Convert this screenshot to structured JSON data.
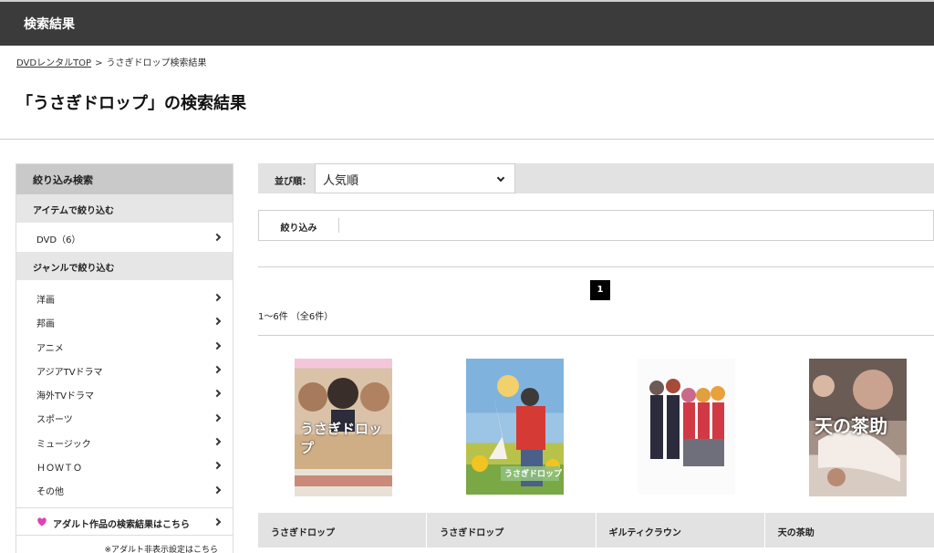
{
  "header": {
    "title": "検索結果"
  },
  "breadcrumb": {
    "home": "DVDレンタルTOP",
    "separator": ">",
    "current": "うさぎドロップ検索結果"
  },
  "page_title": "「うさぎドロップ」の検索結果",
  "sidebar": {
    "heading": "絞り込み検索",
    "item_section": "アイテムで絞り込む",
    "item_filter": "DVD（6）",
    "genre_section": "ジャンルで絞り込む",
    "genres": [
      "洋画",
      "邦画",
      "アニメ",
      "アジアTVドラマ",
      "海外TVドラマ",
      "スポーツ",
      "ミュージック",
      "ＨＯＷＴＯ",
      "その他"
    ],
    "adult_link": "アダルト作品の検索結果はこちら",
    "adult_note": "※アダルト非表示設定はこちら"
  },
  "sort": {
    "label": "並び順：",
    "selected": "人気順"
  },
  "filter_button": "絞り込み",
  "pagination": {
    "current": "1"
  },
  "result_count": "1〜6件 （全6件）",
  "products": [
    {
      "title": "うさぎドロップ",
      "cover_text": "うさぎドロップ"
    },
    {
      "title": "うさぎドロップ",
      "cover_text": "うさぎドロップ"
    },
    {
      "title": "ギルティクラウン",
      "cover_text": ""
    },
    {
      "title": "天の茶助",
      "cover_text": "天の茶助"
    }
  ],
  "colors": {
    "header_bg": "#3b3b3b",
    "heart": "#e040b8"
  }
}
